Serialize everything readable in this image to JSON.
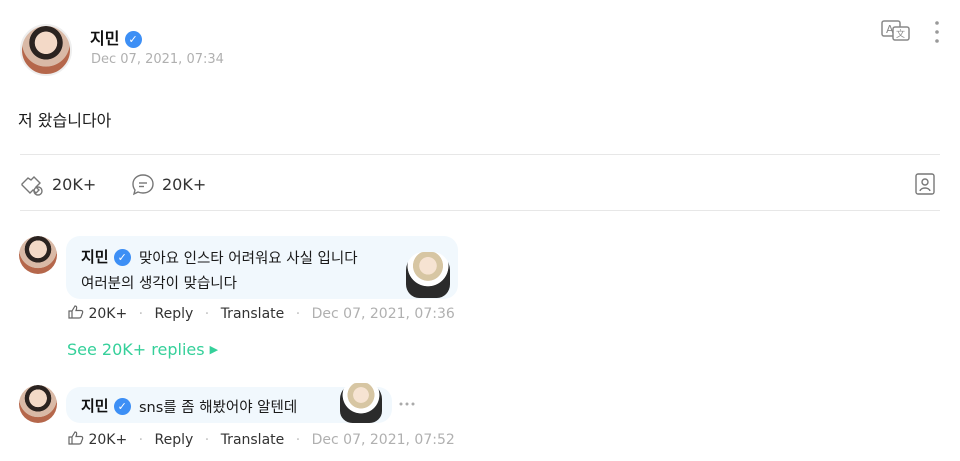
{
  "post": {
    "author": "지민",
    "date": "Dec 07, 2021, 07:34",
    "body": "저 왔습니다아",
    "likes": "20K+",
    "comments": "20K+"
  },
  "comments": [
    {
      "author": "지민",
      "line1": "맞아요 인스타 어려워요 사실 입니다",
      "line2": "여러분의 생각이 맞습니다",
      "likes": "20K+",
      "reply_label": "Reply",
      "translate_label": "Translate",
      "date": "Dec 07, 2021, 07:36",
      "see_replies": "See 20K+ replies"
    },
    {
      "author": "지민",
      "line1": "sns를 좀 해봤어야 알텐데",
      "likes": "20K+",
      "reply_label": "Reply",
      "translate_label": "Translate",
      "date": "Dec 07, 2021, 07:52"
    }
  ],
  "colors": {
    "accent": "#3d8ff5",
    "replies_link": "#35d09a",
    "bubble": "#f1f8fd"
  },
  "icons": [
    "translate-icon",
    "more-vertical-icon",
    "like-icon",
    "comment-icon",
    "bookmark-icon",
    "verified-icon",
    "more-horizontal-icon"
  ]
}
